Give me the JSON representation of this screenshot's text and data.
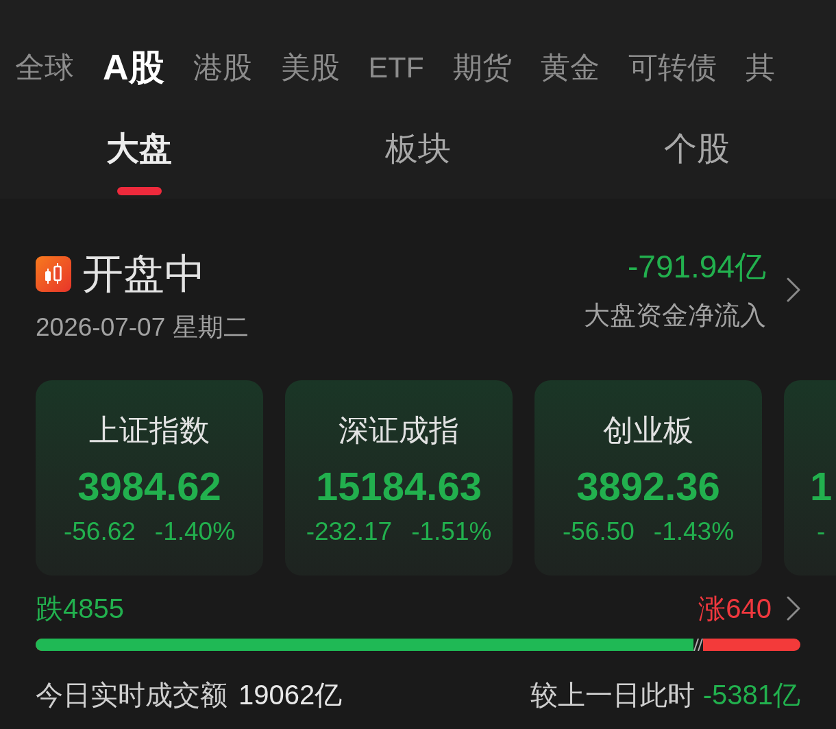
{
  "market_tabs": [
    {
      "label": "全球",
      "selected": false
    },
    {
      "label": "A股",
      "selected": true
    },
    {
      "label": "港股",
      "selected": false
    },
    {
      "label": "美股",
      "selected": false
    },
    {
      "label": "ETF",
      "selected": false
    },
    {
      "label": "期货",
      "selected": false
    },
    {
      "label": "黄金",
      "selected": false
    },
    {
      "label": "可转债",
      "selected": false
    },
    {
      "label": "其",
      "selected": false
    }
  ],
  "sub_tabs": [
    {
      "label": "大盘",
      "selected": true
    },
    {
      "label": "板块",
      "selected": false
    },
    {
      "label": "个股",
      "selected": false
    }
  ],
  "session": {
    "status": "开盘中",
    "date": "2026-07-07 星期二",
    "net_flow": "-791.94亿",
    "net_flow_label": "大盘资金净流入"
  },
  "indices": [
    {
      "kind": "full",
      "name": "上证指数",
      "value": "3984.62",
      "change": "-56.62",
      "change_pct": "-1.40%"
    },
    {
      "kind": "full",
      "name": "深证成指",
      "value": "15184.63",
      "change": "-232.17",
      "change_pct": "-1.51%"
    },
    {
      "kind": "full",
      "name": "创业板",
      "value": "3892.36",
      "change": "-56.50",
      "change_pct": "-1.43%"
    },
    {
      "kind": "clipped",
      "value": "1",
      "change": "-"
    }
  ],
  "breadth": {
    "falls": "跌4855",
    "rises": "涨640",
    "level": 0.86
  },
  "turnover": {
    "label": "今日实时成交额",
    "value": "19062亿",
    "compare_label": "较上一日此时",
    "compare_value": "-5381亿"
  }
}
